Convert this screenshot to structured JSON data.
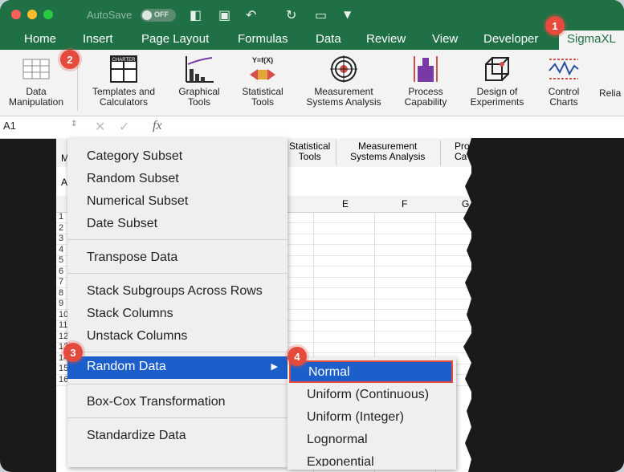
{
  "titlebar": {
    "autosave_label": "AutoSave",
    "toggle_label": "OFF"
  },
  "menubar": {
    "tabs": [
      "Home",
      "Insert",
      "Page Layout",
      "Formulas",
      "Data",
      "Review",
      "View",
      "Developer",
      "SigmaXL"
    ],
    "active_tab": "SigmaXL"
  },
  "ribbon": {
    "groups": [
      {
        "line1": "Data",
        "line2": "Manipulation"
      },
      {
        "line1": "Templates and",
        "line2": "Calculators"
      },
      {
        "line1": "Graphical",
        "line2": "Tools"
      },
      {
        "line1": "Statistical",
        "line2": "Tools"
      },
      {
        "line1": "Measurement",
        "line2": "Systems Analysis"
      },
      {
        "line1": "Process",
        "line2": "Capability"
      },
      {
        "line1": "Design of",
        "line2": "Experiments"
      },
      {
        "line1": "Control",
        "line2": "Charts"
      },
      {
        "line1": "Relia",
        "line2": ""
      }
    ],
    "templates_icon_text": "CHARTER",
    "stat_icon_text": "Y=f(X)"
  },
  "formula_bar": {
    "cell_ref": "A1",
    "fx": "fx"
  },
  "sheet": {
    "ribbon_echo": [
      "Statistical",
      "Tools",
      "Measurement",
      "Systems Analysis",
      "Pro",
      "Ca"
    ],
    "col_headers": [
      "E",
      "F",
      "G"
    ],
    "row_numbers": [
      "1",
      "2",
      "3",
      "4",
      "5",
      "6",
      "7",
      "8",
      "9",
      "10",
      "11",
      "12",
      "13",
      "14",
      "15",
      "16"
    ],
    "row_prefix": [
      "M",
      "A"
    ]
  },
  "menu": {
    "items": [
      "Category Subset",
      "Random Subset",
      "Numerical Subset",
      "Date Subset",
      "Transpose Data",
      "Stack Subgroups Across Rows",
      "Stack Columns",
      "Unstack Columns",
      "Random Data",
      "Box-Cox Transformation",
      "Standardize Data"
    ],
    "submenu_arrow": "▶"
  },
  "submenu": {
    "items": [
      "Normal",
      "Uniform (Continuous)",
      "Uniform (Integer)",
      "Lognormal",
      "Exponential"
    ]
  },
  "badges": [
    "1",
    "2",
    "3",
    "4"
  ],
  "colors": {
    "excel_green": "#1f7145",
    "highlight_blue": "#1c5fcb",
    "badge_red": "#e44b3c"
  }
}
